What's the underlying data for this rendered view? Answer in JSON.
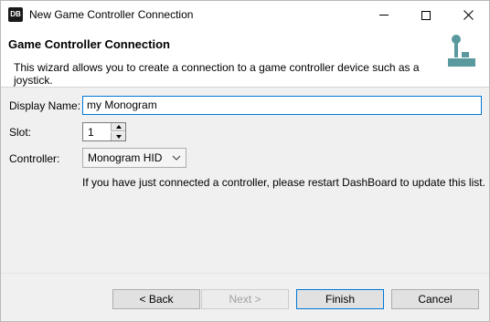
{
  "window": {
    "title": "New Game Controller Connection",
    "app_icon_text": "DB"
  },
  "banner": {
    "title": "Game Controller Connection",
    "description": "This wizard allows you to create a connection to a game controller device such as a joystick.",
    "icon": "joystick-icon"
  },
  "form": {
    "display_name_label": "Display Name:",
    "display_name_value": "my Monogram",
    "slot_label": "Slot:",
    "slot_value": "1",
    "controller_label": "Controller:",
    "controller_value": "Monogram HID",
    "hint": "If you have just connected a controller, please restart DashBoard to update this list."
  },
  "buttons": {
    "back": "< Back",
    "next": "Next >",
    "finish": "Finish",
    "cancel": "Cancel"
  },
  "colors": {
    "focus_border": "#0078d7",
    "icon_teal": "#5a9a9e",
    "disabled_text": "#a0a0a0"
  }
}
